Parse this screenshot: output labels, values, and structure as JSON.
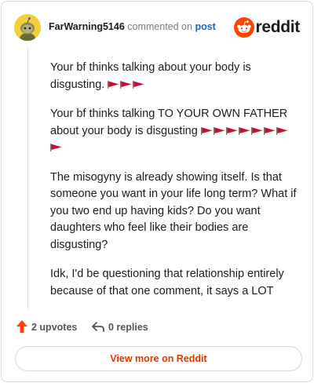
{
  "header": {
    "username": "FarWarning5146",
    "commented_text": "commented on",
    "post_link": "post",
    "brand": "reddit",
    "avatar_icon": "snoo-avatar-icon",
    "brand_icon": "reddit-logo-icon",
    "brand_color": "#ff4500"
  },
  "comment": {
    "paragraphs": [
      {
        "text": "Your bf thinks talking about your body is disgusting.",
        "flags": 3
      },
      {
        "text": "Your bf thinks talking TO YOUR OWN FATHER about your body is disgusting",
        "flags": 8
      },
      {
        "text": "The misogyny is already showing itself. Is that someone you want in your life long term? What if you two end up having kids? Do you want daughters who feel like their bodies are disgusting?",
        "flags": 0
      },
      {
        "text": "Idk, I'd be questioning that relationship entirely because of that one comment, it says a LOT",
        "flags": 0
      }
    ],
    "flag_icon": "red-flag-icon",
    "flag_color": "#c8102e"
  },
  "actions": {
    "upvotes": "2 upvotes",
    "replies": "0 replies",
    "upvote_icon": "upvote-arrow-icon",
    "reply_icon": "reply-arrow-icon",
    "upvote_color": "#ff4500"
  },
  "footer": {
    "view_more": "View more on Reddit",
    "view_more_color": "#d93a00"
  }
}
